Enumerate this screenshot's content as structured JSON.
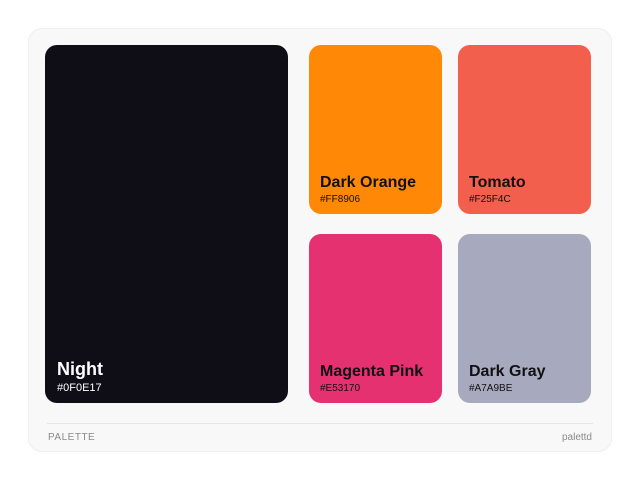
{
  "palette": {
    "swatches": [
      {
        "name": "Night",
        "hex": "#0F0E17",
        "color": "#0F0E17",
        "text_color": "#ffffff"
      },
      {
        "name": "Dark Orange",
        "hex": "#FF8906",
        "color": "#FF8906",
        "text_color": "#111111"
      },
      {
        "name": "Tomato",
        "hex": "#F25F4C",
        "color": "#F25F4C",
        "text_color": "#111111"
      },
      {
        "name": "Magenta Pink",
        "hex": "#E53170",
        "color": "#E53170",
        "text_color": "#111111"
      },
      {
        "name": "Dark Gray",
        "hex": "#A7A9BE",
        "color": "#A7A9BE",
        "text_color": "#111111"
      }
    ]
  },
  "footer": {
    "label": "PALETTE",
    "brand": "palettd"
  }
}
